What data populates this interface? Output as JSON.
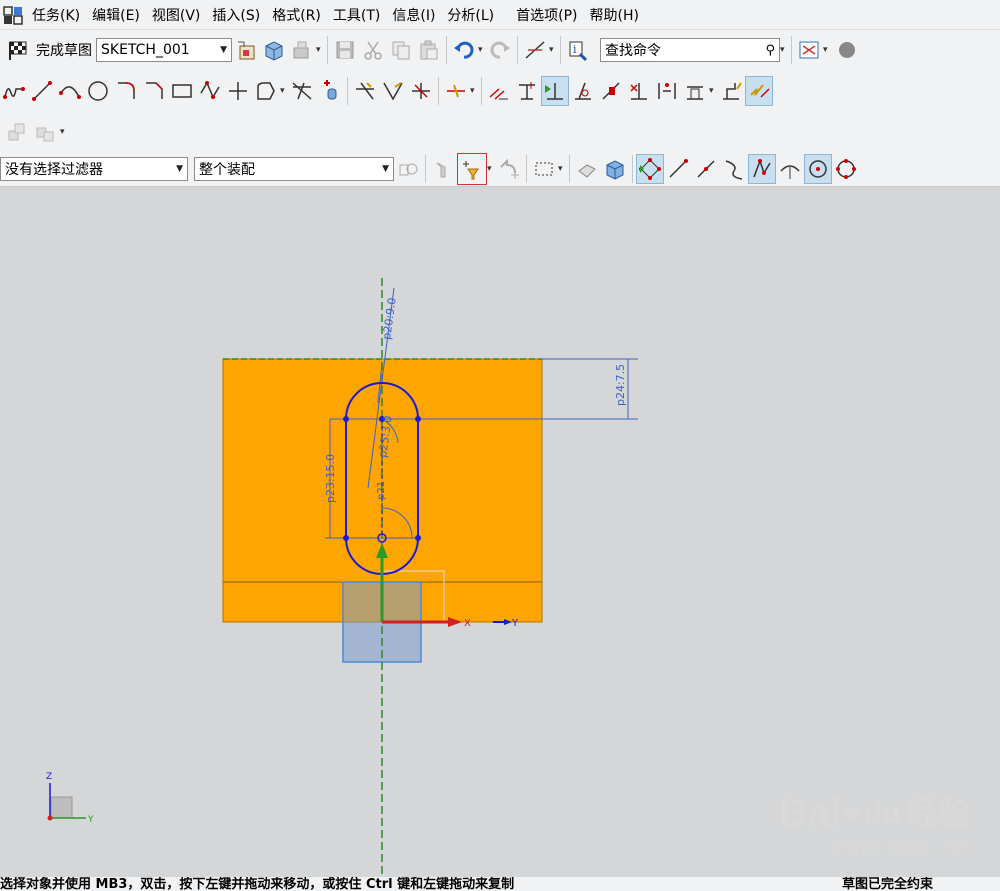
{
  "menubar": {
    "items": [
      "任务(K)",
      "编辑(E)",
      "视图(V)",
      "插入(S)",
      "格式(R)",
      "工具(T)",
      "信息(I)",
      "分析(L)",
      "首选项(P)",
      "帮助(H)"
    ]
  },
  "toolbar1": {
    "finish_sketch_label": "完成草图",
    "sketch_name": "SKETCH_001",
    "find_command_placeholder": "查找命令"
  },
  "toolbar4": {
    "selection_filter": "没有选择过滤器",
    "assembly_scope": "整个装配"
  },
  "sketch": {
    "dim_p20": "p20:9.0",
    "dim_p24": "p24:7.5",
    "dim_p23": "p23:15.0",
    "dim_p25": "p25:3.0",
    "dim_p21": "p21",
    "axis_x": "X",
    "axis_y": "Y",
    "triad_z": "Z",
    "triad_y": "Y"
  },
  "colors": {
    "part_face": "#ffa500",
    "sketch_curve": "#1a1ad8",
    "dimension": "#3a64c8",
    "datum_axis": "#2a8a2a",
    "x_axis": "#d02020"
  },
  "status": {
    "left_text": "选择对象并使用 MB3，双击，按下左键并拖动来移动，或按住 Ctrl 键和左键拖动来复制",
    "right_text": "草图已完全约束"
  },
  "watermark": {
    "brand": "Bai",
    "paw": "du",
    "cn": "经验",
    "url": "jingyan.baidu.com"
  }
}
